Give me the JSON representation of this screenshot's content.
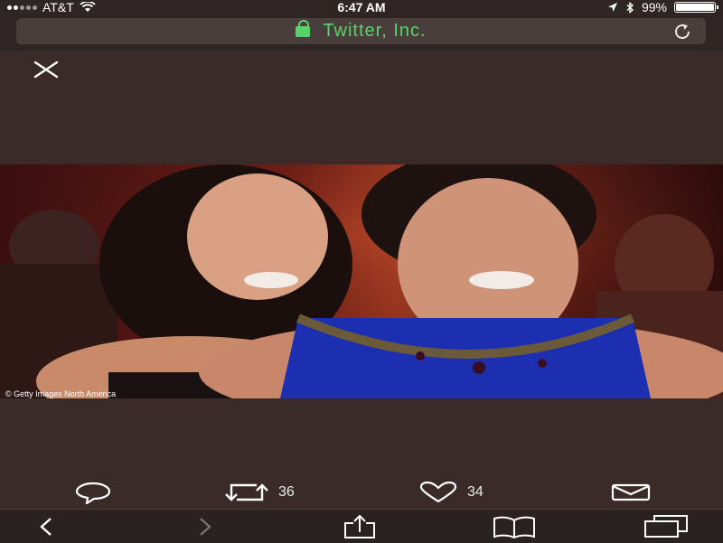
{
  "status": {
    "carrier": "AT&T",
    "time": "6:47 AM",
    "battery": "99%",
    "battery_level": 0.99
  },
  "url_bar": {
    "site": "Twitter, Inc."
  },
  "photo": {
    "credit": "© Getty Images North America"
  },
  "actions": {
    "reply_icon": "reply-icon",
    "retweet_count": "36",
    "like_count": "34",
    "dm_icon": "envelope-icon"
  },
  "toolbar": {
    "items": [
      "back-icon",
      "forward-icon",
      "share-icon",
      "bookmarks-icon",
      "tabs-icon"
    ]
  },
  "colors": {
    "background": "#3a2b29",
    "url_text": "#58d36b",
    "chrome": "#2f2524"
  }
}
